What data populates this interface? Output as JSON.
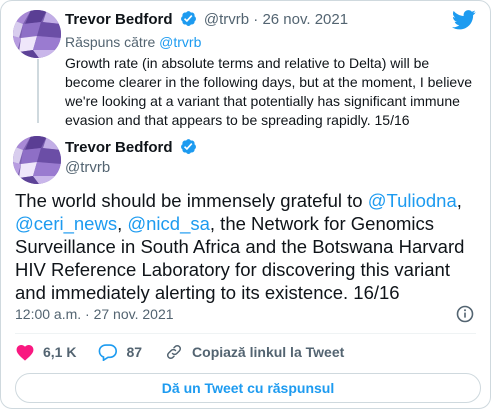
{
  "reply_tweet": {
    "author_name": "Trevor Bedford",
    "author_handle": "@trvrb",
    "separator": "·",
    "date": "26 nov. 2021",
    "replying_label": "Răspuns către",
    "replying_to": "@trvrb",
    "text": "Growth rate (in absolute terms and relative to Delta) will be become clearer in the following days, but at the moment, I believe we're looking at a variant that potentially has significant immune evasion and that appears to be spreading rapidly. 15/16"
  },
  "main_tweet": {
    "author_name": "Trevor Bedford",
    "author_handle": "@trvrb",
    "text_parts": {
      "p1": "The world should be immensely grateful to ",
      "m1": "@Tuliodna",
      "p2": ", ",
      "m2": "@ceri_news",
      "p3": ", ",
      "m3": "@nicd_sa",
      "p4": ", the Network for Genomics Surveillance in South Africa and the Botswana Harvard HIV Reference Laboratory for discovering this variant and immediately alerting to its existence. 16/16"
    },
    "timestamp": "12:00 a.m. · 27 nov. 2021"
  },
  "actions": {
    "like_count": "6,1 K",
    "reply_count": "87",
    "copy_link_label": "Copiază linkul la Tweet"
  },
  "reply_button_label": "Dă un Tweet cu răspunsul",
  "colors": {
    "accent": "#1d9bf0",
    "like": "#f91880",
    "text": "#0f1419",
    "muted": "#536471"
  },
  "icons": [
    "avatar",
    "verified-badge-icon",
    "twitter-bird-icon",
    "info-icon",
    "heart-icon",
    "comment-icon",
    "link-icon"
  ]
}
